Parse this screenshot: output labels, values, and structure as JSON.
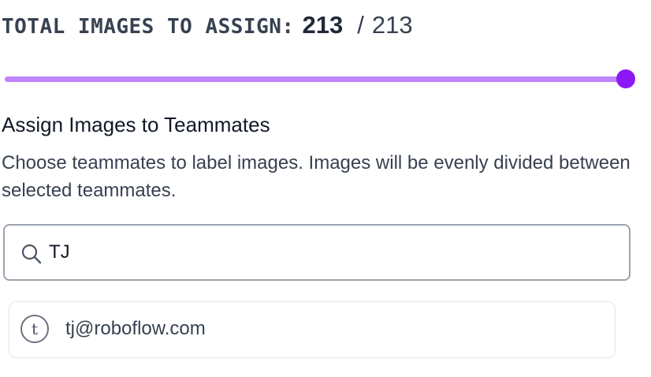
{
  "header": {
    "total_label": "TOTAL IMAGES TO ASSIGN:",
    "assigned_count": "213",
    "separator": "/",
    "total_count": "213"
  },
  "slider": {
    "value": 213,
    "max": 213,
    "fill_fraction": 1.0,
    "track_color": "#e9d5ff",
    "fill_color": "#c084fc",
    "thumb_color": "#8b18f5"
  },
  "section": {
    "title": "Assign Images to Teammates",
    "description": "Choose teammates to label images. Images will be evenly divided between selected teammates."
  },
  "search": {
    "value": "TJ",
    "icon": "search-icon"
  },
  "results": [
    {
      "avatar_initial": "t",
      "email": "tj@roboflow.com",
      "icon": "avatar-icon"
    }
  ]
}
